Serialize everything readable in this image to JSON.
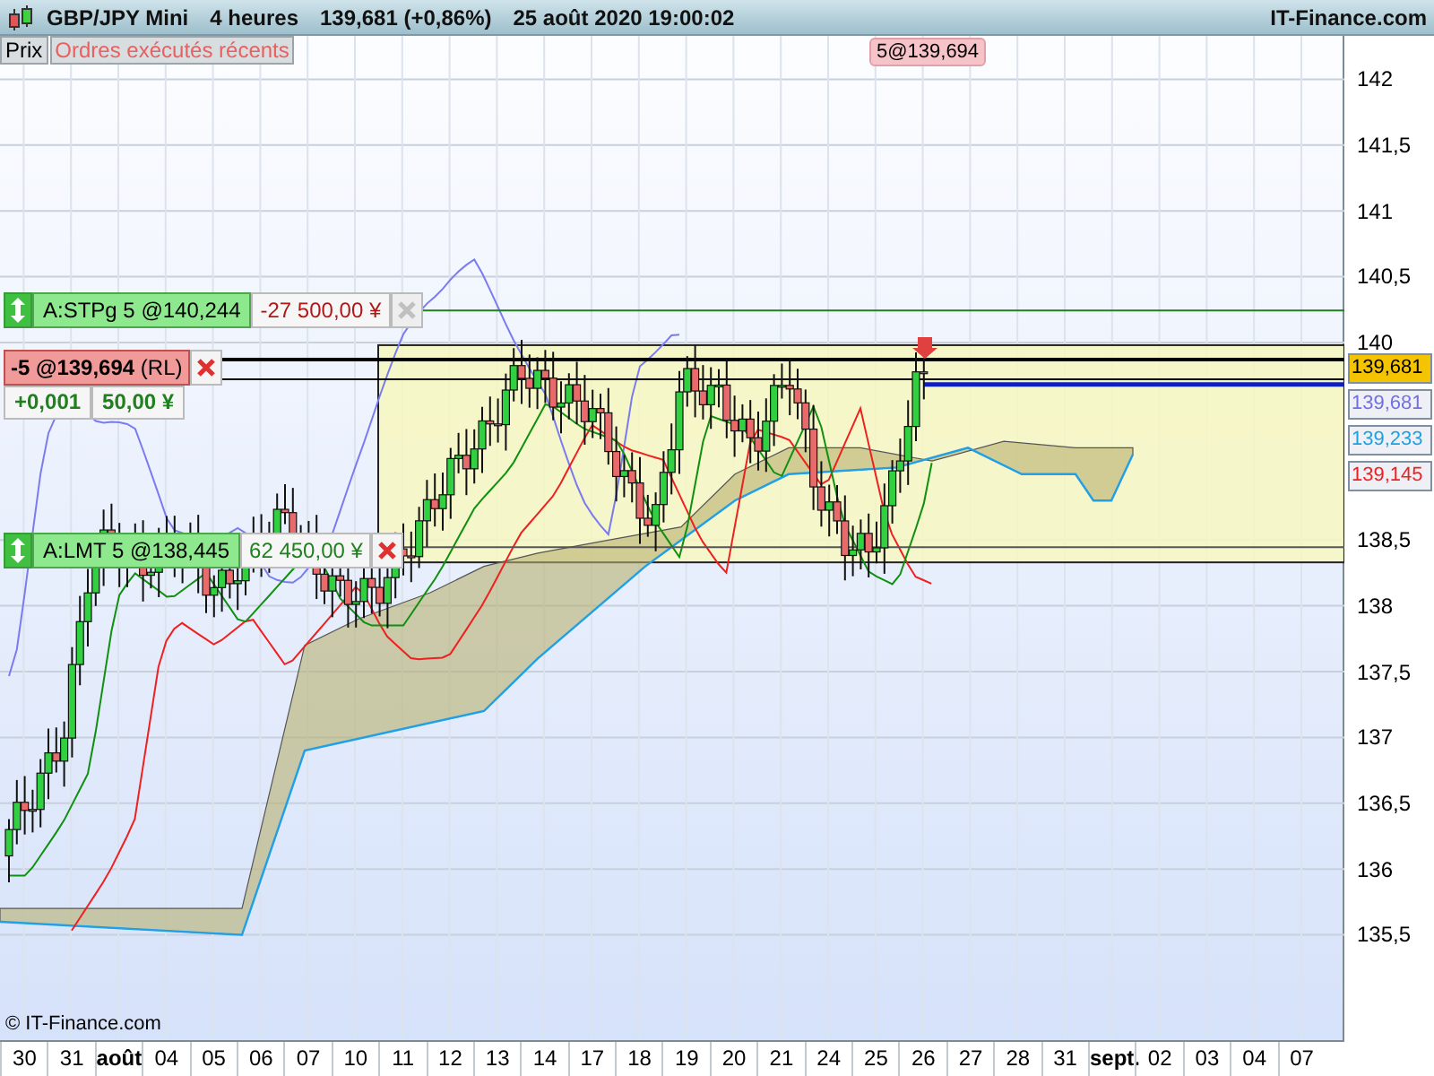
{
  "header": {
    "symbol": "GBP/JPY Mini",
    "timeframe": "4 heures",
    "price": "139,681 (+0,86%)",
    "datetime": "25 août 2020 19:00:02",
    "brand": "IT-Finance.com"
  },
  "legend": [
    {
      "label": "Prix",
      "color": "#000000"
    },
    {
      "label": "Ordres exécutés récents",
      "color": "#e86060"
    }
  ],
  "trade_marker": "5@139,694",
  "orders": [
    {
      "kind": "stop",
      "label": "A:STPg  5 @140,244",
      "amount": "-27 500,00 ¥",
      "disabled": true
    },
    {
      "kind": "limit",
      "label": "A:LMT  5 @138,445",
      "amount": "62 450,00 ¥",
      "disabled": false
    }
  ],
  "position": {
    "label": "**-5 @139,694** (RL)",
    "change": "+0,001",
    "profit": "50,00 ¥"
  },
  "price_axis": {
    "ticks": [
      "142",
      "141,5",
      "141",
      "140,5",
      "140",
      "138,5",
      "138",
      "137,5",
      "137",
      "136,5",
      "136",
      "135,5"
    ],
    "badges": [
      {
        "label": "139,681",
        "color": "#f5c400"
      },
      {
        "label": "139,681",
        "color": "#7070e0"
      },
      {
        "label": "139,233",
        "color": "#20a0e0"
      },
      {
        "label": "139,145",
        "color": "#ee2020"
      }
    ]
  },
  "time_axis": [
    {
      "label": "30",
      "bold": false
    },
    {
      "label": "31",
      "bold": false
    },
    {
      "label": "août",
      "bold": true
    },
    {
      "label": "04",
      "bold": false
    },
    {
      "label": "05",
      "bold": false
    },
    {
      "label": "06",
      "bold": false
    },
    {
      "label": "07",
      "bold": false
    },
    {
      "label": "10",
      "bold": false
    },
    {
      "label": "11",
      "bold": false
    },
    {
      "label": "12",
      "bold": false
    },
    {
      "label": "13",
      "bold": false
    },
    {
      "label": "14",
      "bold": false
    },
    {
      "label": "17",
      "bold": false
    },
    {
      "label": "18",
      "bold": false
    },
    {
      "label": "19",
      "bold": false
    },
    {
      "label": "20",
      "bold": false
    },
    {
      "label": "21",
      "bold": false
    },
    {
      "label": "24",
      "bold": false
    },
    {
      "label": "25",
      "bold": false
    },
    {
      "label": "26",
      "bold": false
    },
    {
      "label": "27",
      "bold": false
    },
    {
      "label": "28",
      "bold": false
    },
    {
      "label": "31",
      "bold": false
    },
    {
      "label": "sept.",
      "bold": true
    },
    {
      "label": "02",
      "bold": false
    },
    {
      "label": "03",
      "bold": false
    },
    {
      "label": "04",
      "bold": false
    },
    {
      "label": "07",
      "bold": false
    }
  ],
  "copyright": "© IT-Finance.com"
}
